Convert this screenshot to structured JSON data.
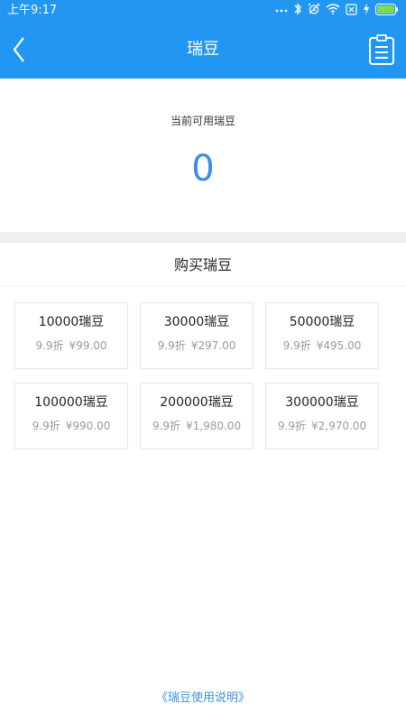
{
  "status_bar": {
    "time": "上午9:17",
    "icons": [
      "more-dots-icon",
      "bluetooth-icon",
      "alarm-icon",
      "wifi-icon",
      "sim-disabled-icon",
      "charging-icon",
      "battery-icon"
    ]
  },
  "header": {
    "title": "瑞豆",
    "back_icon": "chevron-left-icon",
    "right_icon": "clipboard-icon"
  },
  "balance": {
    "label": "当前可用瑞豆",
    "value": "0"
  },
  "purchase": {
    "title": "购买瑞豆",
    "packages": [
      {
        "name": "10000瑞豆",
        "discount": "9.9折",
        "price": "¥99.00"
      },
      {
        "name": "30000瑞豆",
        "discount": "9.9折",
        "price": "¥297.00"
      },
      {
        "name": "50000瑞豆",
        "discount": "9.9折",
        "price": "¥495.00"
      },
      {
        "name": "100000瑞豆",
        "discount": "9.9折",
        "price": "¥990.00"
      },
      {
        "name": "200000瑞豆",
        "discount": "9.9折",
        "price": "¥1,980.00"
      },
      {
        "name": "300000瑞豆",
        "discount": "9.9折",
        "price": "¥2,970.00"
      }
    ]
  },
  "footer": {
    "link": "《瑞豆使用说明》"
  },
  "colors": {
    "primary": "#2196f3",
    "accent_text": "#3a8ee6",
    "divider": "#eeeff1"
  }
}
